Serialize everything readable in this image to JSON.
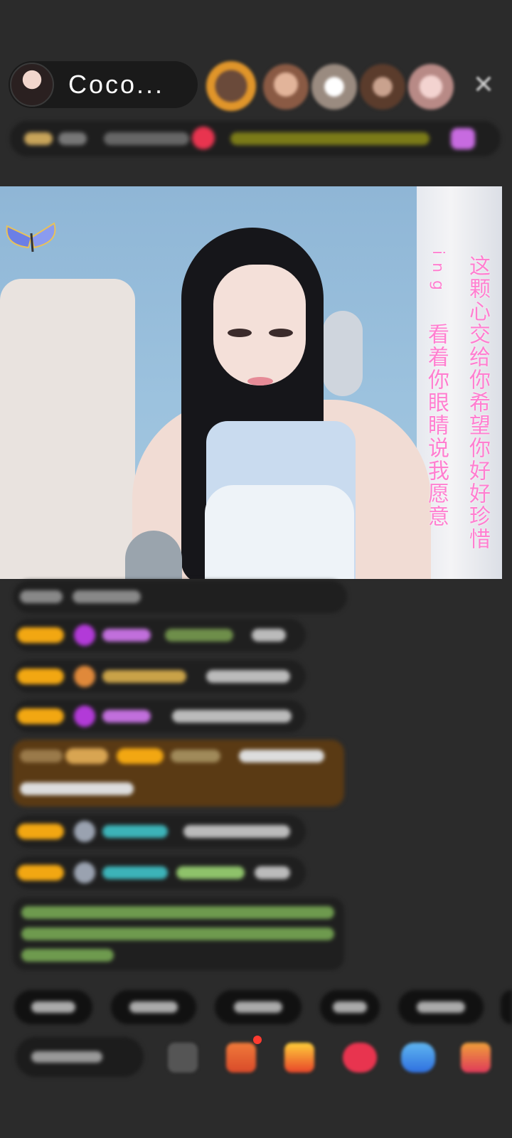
{
  "header": {
    "host_name": "Coco...",
    "close_glyph": "✕",
    "viewer_colors": [
      "#e0952a",
      "#c98a6a",
      "#f0f0f0",
      "#d18a5a",
      "#e8b7b7"
    ]
  },
  "video": {
    "overlay_right": "这颗心交给你希望你好好珍惜",
    "overlay_left_prefix": "i n g",
    "overlay_left": "看着你眼睛说我愿意",
    "overlay_color": "#ff7fd0",
    "butterfly_icon": "butterfly-icon"
  },
  "chat": {
    "badge_color": "#f2a712",
    "highlight_color": "#5a3a14",
    "system_text_color": "#8ec26a"
  },
  "bottom": {
    "chip_count": 6,
    "toolbar_icons": [
      "emoji-icon",
      "gift-box-icon",
      "red-packet-icon",
      "heart-icon",
      "game-icon",
      "more-gift-icon"
    ],
    "notification_dot_color": "#ff3b30"
  }
}
